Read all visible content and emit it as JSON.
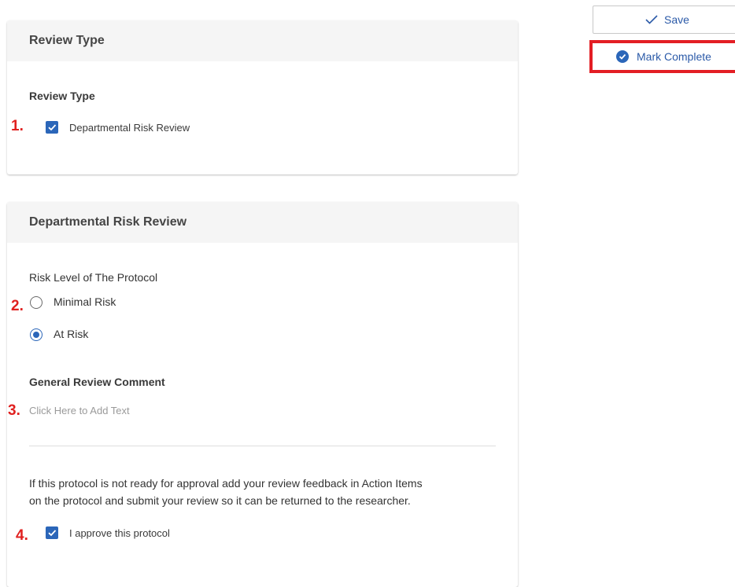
{
  "toolbar": {
    "save_label": "Save",
    "mark_complete_label": "Mark Complete"
  },
  "review_type_card": {
    "header": "Review Type",
    "field_label": "Review Type",
    "step_number": "1.",
    "checkbox_label": "Departmental Risk Review",
    "checked": true
  },
  "risk_card": {
    "header": "Departmental Risk Review",
    "risk_label": "Risk Level of The Protocol",
    "risk_step": "2.",
    "options": [
      {
        "label": "Minimal Risk",
        "selected": false
      },
      {
        "label": "At Risk",
        "selected": true
      }
    ],
    "comment_label": "General Review Comment",
    "comment_step": "3.",
    "comment_placeholder": "Click Here to Add Text",
    "note_line1": "If this protocol is not ready for approval add your review feedback in Action Items",
    "note_line2": "on the protocol and submit your review so it can be returned to the researcher.",
    "approve_step": "4.",
    "approve_label": "I approve this protocol",
    "approve_checked": true
  },
  "colors": {
    "accent": "#2b66b9",
    "highlight": "#e31e24",
    "step_number": "#e0201f"
  }
}
